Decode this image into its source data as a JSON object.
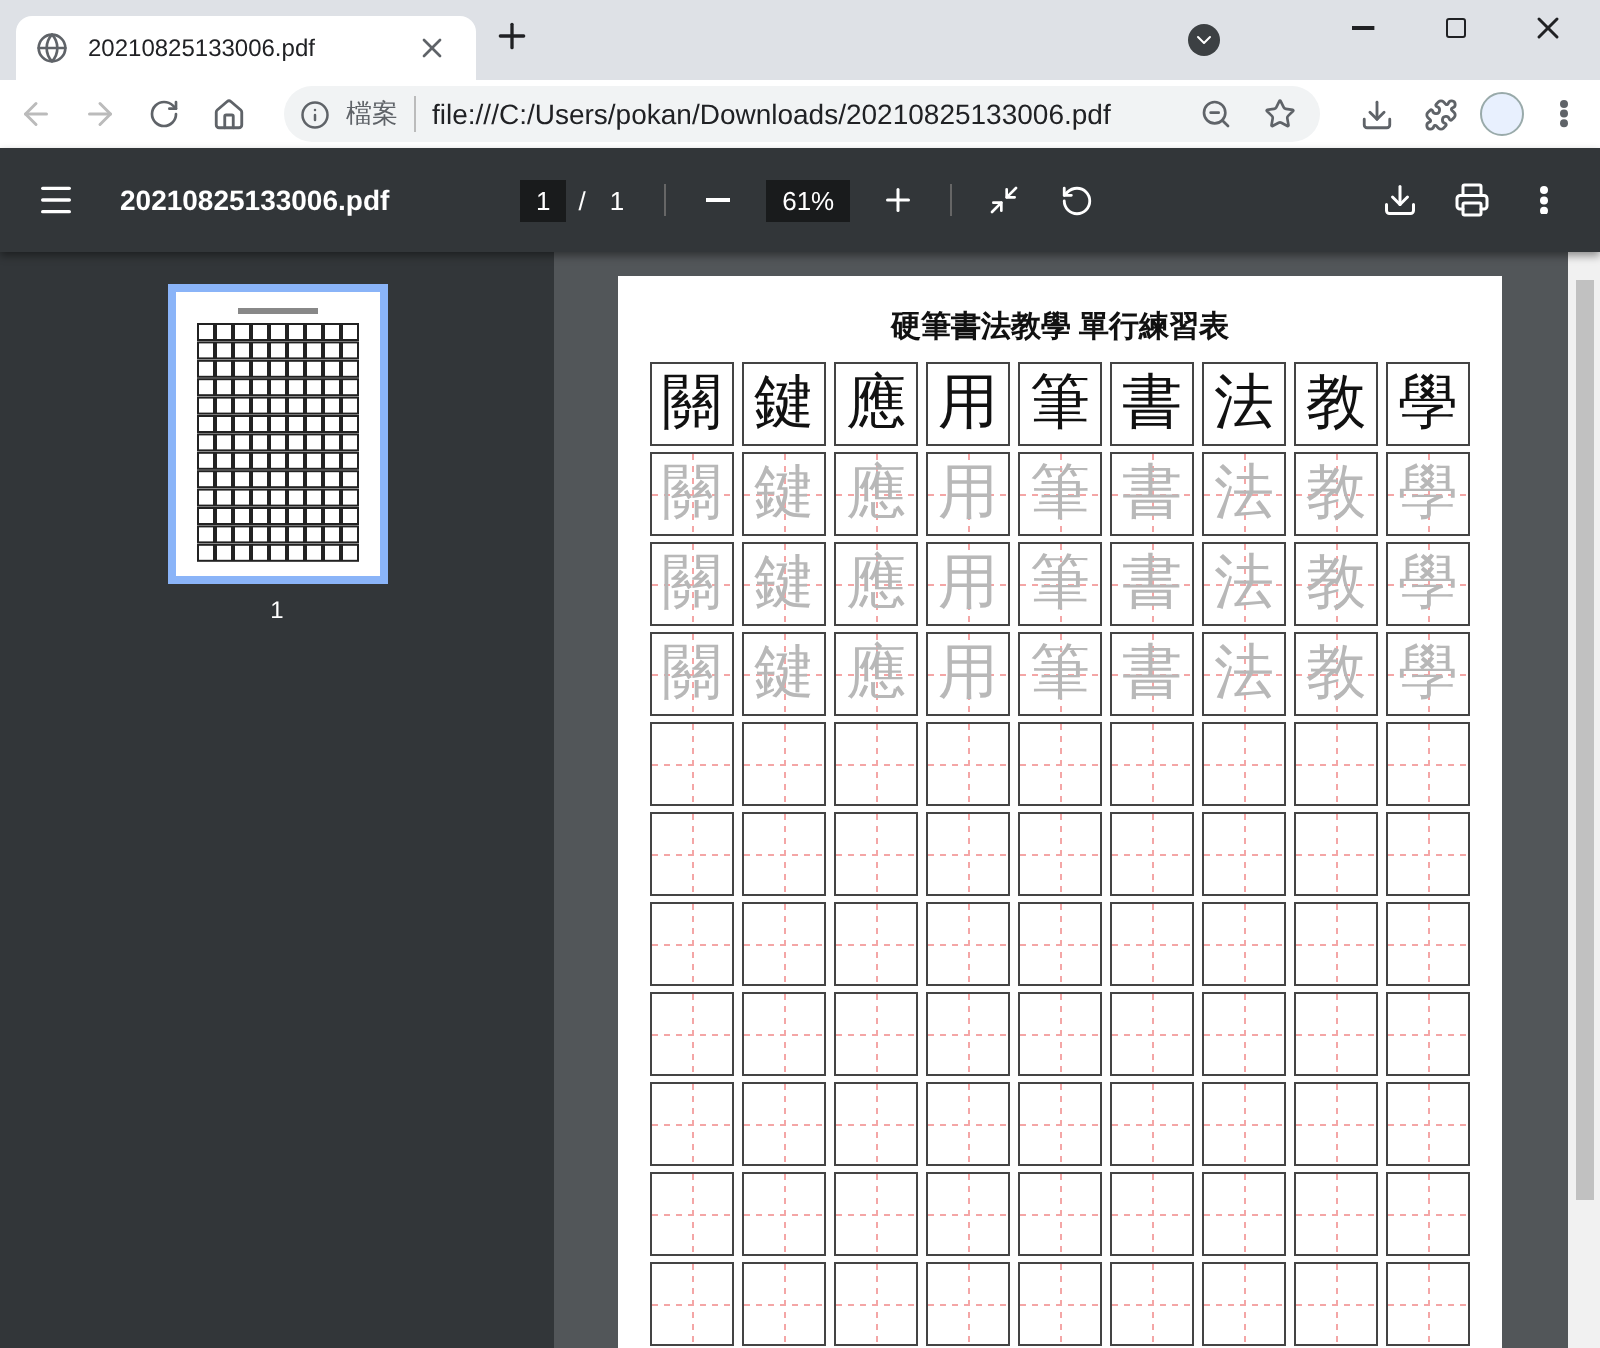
{
  "tabs": [
    {
      "title": "20210825133006.pdf",
      "selected": true
    }
  ],
  "address_bar": {
    "scheme_label": "檔案",
    "url": "file:///C:/Users/pokan/Downloads/20210825133006.pdf"
  },
  "pdf_toolbar": {
    "filename": "20210825133006.pdf",
    "page_current": "1",
    "page_separator": "/",
    "page_total": "1",
    "zoom": "61%"
  },
  "thumbnails": [
    {
      "label": "1",
      "selected": true
    }
  ],
  "document": {
    "title": "硬筆書法教學 單行練習表",
    "rows": [
      {
        "kind": "model",
        "chars": [
          "關",
          "鍵",
          "應",
          "用",
          "筆",
          "書",
          "法",
          "教",
          "學"
        ]
      },
      {
        "kind": "trace",
        "chars": [
          "關",
          "鍵",
          "應",
          "用",
          "筆",
          "書",
          "法",
          "教",
          "學"
        ]
      },
      {
        "kind": "trace",
        "chars": [
          "關",
          "鍵",
          "應",
          "用",
          "筆",
          "書",
          "法",
          "教",
          "學"
        ]
      },
      {
        "kind": "trace",
        "chars": [
          "關",
          "鍵",
          "應",
          "用",
          "筆",
          "書",
          "法",
          "教",
          "學"
        ]
      },
      {
        "kind": "blank"
      },
      {
        "kind": "blank"
      },
      {
        "kind": "blank"
      },
      {
        "kind": "blank"
      },
      {
        "kind": "blank"
      },
      {
        "kind": "blank"
      },
      {
        "kind": "blank"
      },
      {
        "kind": "blank"
      },
      {
        "kind": "blank"
      }
    ]
  }
}
